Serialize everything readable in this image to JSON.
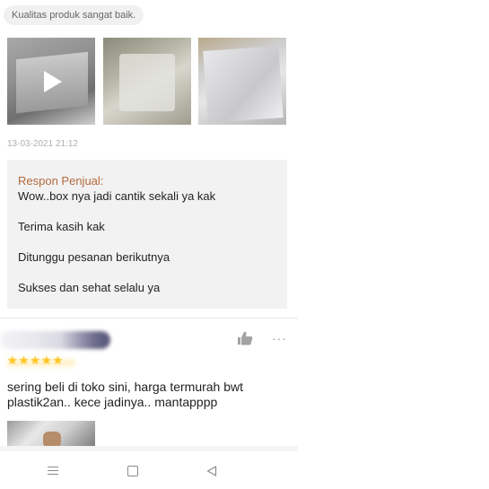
{
  "review_top": {
    "tag": "Kualitas produk sangat baik.",
    "media": [
      {
        "kind": "video",
        "icon": "play-icon"
      },
      {
        "kind": "image"
      },
      {
        "kind": "image"
      }
    ],
    "date": "13-03-2021 21:12"
  },
  "seller_response": {
    "title": "Respon Penjual:",
    "lines": [
      "Wow..box nya jadi cantik sekali ya kak",
      "Terima kasih kak",
      "Ditunggu pesanan berikutnya",
      "Sukses dan sehat selalu ya"
    ]
  },
  "review_next": {
    "rating": 5,
    "text": "sering beli di toko sini, harga termurah bwt plastik2an.. kece jadinya.. mantapppp",
    "actions": {
      "like_icon": "thumbs-up-icon",
      "more_label": "···"
    }
  },
  "navbar": {
    "icons": [
      "menu-icon",
      "home-icon",
      "back-icon"
    ]
  },
  "colors": {
    "response_title": "#b26a3b",
    "star": "#ffc629",
    "reply_bg": "#f2f2f2"
  }
}
